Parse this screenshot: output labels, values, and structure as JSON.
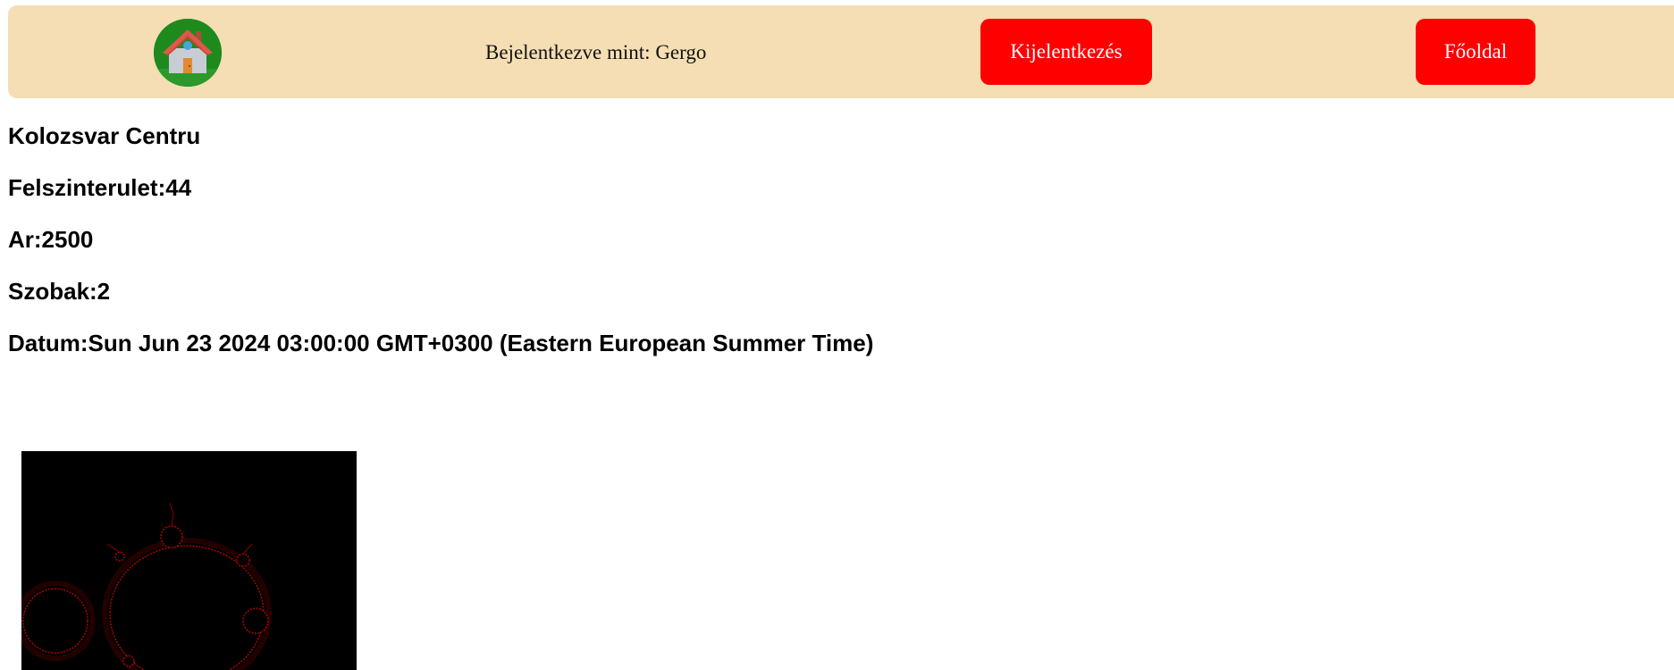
{
  "header": {
    "logo_icon": "house-icon",
    "logged_in_text": "Bejelentkezve mint: Gergo",
    "logout_label": "Kijelentkezés",
    "home_label": "Főoldal"
  },
  "listing": {
    "name": "Kolozsvar Centru",
    "area": "Felszinterulet:44",
    "price": "Ar:2500",
    "rooms": "Szobak:2",
    "date": "Datum:Sun Jun 23 2024 03:00:00 GMT+0300 (Eastern European Summer Time)"
  },
  "colors": {
    "navbar_bg": "#f5deb3",
    "button_bg": "#ff0000",
    "button_text": "#ffffff",
    "logo_bg": "#1e8a1e"
  }
}
